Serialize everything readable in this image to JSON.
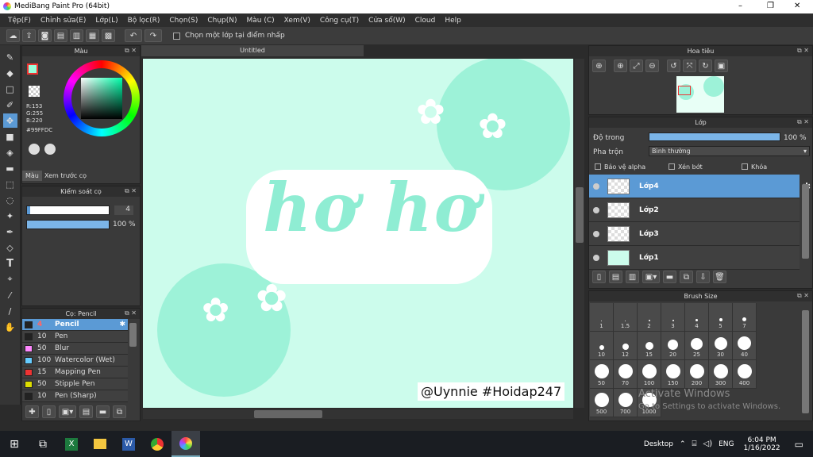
{
  "app": {
    "title": "MediBang Paint Pro (64bit)",
    "window_buttons": [
      "–",
      "❐",
      "✕"
    ]
  },
  "menu": [
    "Tệp(F)",
    "Chỉnh sửa(E)",
    "Lớp(L)",
    "Bộ lọc(R)",
    "Chọn(S)",
    "Chụp(N)",
    "Màu (C)",
    "Xem(V)",
    "Công cụ(T)",
    "Cửa sổ(W)",
    "Cloud",
    "Help"
  ],
  "toolbar": {
    "checkbox_label": "Chọn một lớp tại điểm nhấp"
  },
  "color_panel": {
    "title": "Màu",
    "r": "R:153",
    "g": "G:255",
    "b": "B:220",
    "hex": "#99FFDC",
    "tab1": "Màu",
    "tab2": "Xem trước cọ",
    "primary_color": "#99FFDC"
  },
  "brush_control": {
    "title": "Kiểm soát cọ",
    "size": "4",
    "opacity": "100 %"
  },
  "brush_list": {
    "title": "Cọ: Pencil",
    "items": [
      {
        "size": "4",
        "name": "Pencil",
        "color": "#222222",
        "selected": true
      },
      {
        "size": "10",
        "name": "Pen",
        "color": "#222222"
      },
      {
        "size": "50",
        "name": "Blur",
        "color": "#ff88ff"
      },
      {
        "size": "100",
        "name": "Watercolor (Wet)",
        "color": "#66ccff"
      },
      {
        "size": "15",
        "name": "Mapping Pen",
        "color": "#ee3333"
      },
      {
        "size": "50",
        "name": "Stipple Pen",
        "color": "#dddd00"
      },
      {
        "size": "10",
        "name": "Pen (Sharp)",
        "color": "#222222"
      }
    ]
  },
  "canvas": {
    "tab": "Untitled",
    "text": "hơ hơ",
    "watermark": "@Uynnie #Hoidap247"
  },
  "navigator": {
    "title": "Hoa tiêu"
  },
  "layers": {
    "title": "Lớp",
    "opacity_label": "Độ trong",
    "opacity_value": "100 %",
    "blend_label": "Pha trộn",
    "blend_value": "Bình thường",
    "protect_alpha": "Bảo vệ alpha",
    "clipping": "Xén bớt",
    "lock": "Khóa",
    "items": [
      {
        "name": "Lớp4",
        "selected": true
      },
      {
        "name": "Lớp2"
      },
      {
        "name": "Lớp3"
      },
      {
        "name": "Lớp1"
      }
    ]
  },
  "brush_size": {
    "title": "Brush Size",
    "sizes": [
      "1",
      "1.5",
      "2",
      "3",
      "4",
      "5",
      "7",
      "10",
      "12",
      "15",
      "20",
      "25",
      "30",
      "40",
      "50",
      "70",
      "100",
      "150",
      "200",
      "300",
      "400",
      "500",
      "700",
      "1000"
    ]
  },
  "activate": {
    "line1": "Activate Windows",
    "line2": "Go to Settings to activate Windows."
  },
  "taskbar": {
    "desktop": "Desktop",
    "lang": "ENG",
    "time": "6:04 PM",
    "date": "1/16/2022"
  }
}
